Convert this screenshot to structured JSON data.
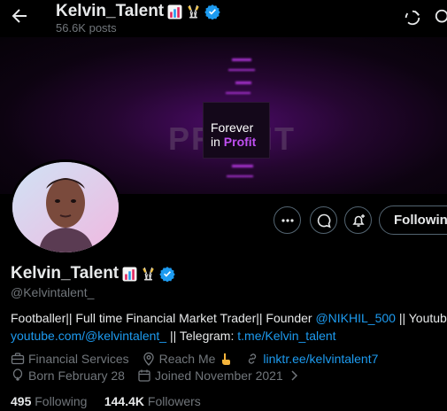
{
  "header": {
    "name": "Kelvin_Talent",
    "post_count": "56.6K posts"
  },
  "banner": {
    "background_word": "PROFIT",
    "line1": "Forever",
    "line2_prefix": "in",
    "line2_accent": "Profit"
  },
  "actions": {
    "follow_label": "Following"
  },
  "profile": {
    "name": "Kelvin_Talent",
    "handle": "@Kelvintalent_",
    "bio": {
      "line1_text": "Footballer|| Full time Financial Market Trader|| Founder ",
      "line1_mention": "@NIKHIL_500",
      "line1_suffix": " || Youtube:",
      "line2_link": "youtube.com/@kelvintalent_",
      "line2_text": " || Telegram: ",
      "line2_link2": "t.me/Kelvin_talent"
    },
    "category": "Financial Services",
    "location": "Reach Me",
    "website": "linktr.ee/kelvintalent7",
    "birthday": "Born February 28",
    "joined": "Joined November 2021"
  },
  "stats": {
    "following_count": "495",
    "following_label": "Following",
    "followers_count": "144.4K",
    "followers_label": "Followers"
  },
  "colors": {
    "accent": "#1d9bf0",
    "muted": "#71767b",
    "text": "#e7e9ea",
    "banner_purple": "#c04ff2"
  }
}
